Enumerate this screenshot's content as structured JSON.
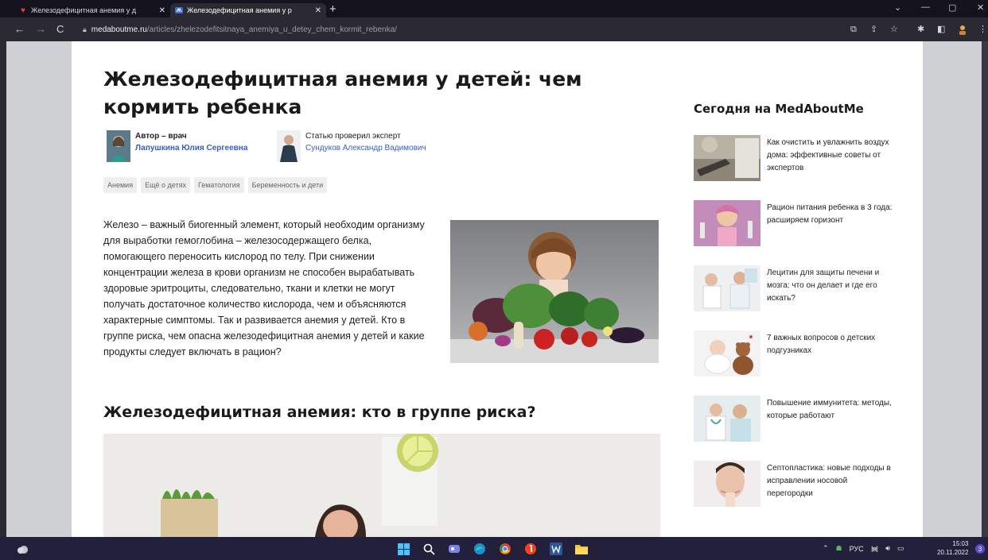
{
  "browser": {
    "tabs": [
      {
        "title": "Железодефицитная анемия у д",
        "close": "✕",
        "active": false
      },
      {
        "title": "Железодефицитная анемия у р",
        "close": "✕",
        "active": true
      }
    ],
    "new_tab": "+",
    "url_domain": "medaboutme.ru",
    "url_path": "/articles/zhelezodefitsitnaya_anemiya_u_detey_chem_kormit_rebenka/",
    "window_controls": {
      "min": "—",
      "max": "▢",
      "close": "✕"
    }
  },
  "article": {
    "title": "Железодефицитная анемия у детей: чем кормить ребенка",
    "author": {
      "label": "Автор – врач",
      "name": "Лапушкина Юлия Сергеевна"
    },
    "expert": {
      "label": "Статью проверил эксперт",
      "name": "Сундуков Александр Вадимович"
    },
    "tags": [
      "Анемия",
      "Ещё о детях",
      "Гематология",
      "Беременность и дети"
    ],
    "intro": "Железо – важный биогенный элемент, который необходим организму для выработки гемоглобина – железосодержащего белка, помогающего переносить кислород по телу. При снижении концентрации железа в крови организм не способен вырабатывать здоровые эритроциты, следовательно, ткани и клетки не могут получать достаточное количество кислорода, чем и объясняются характерные симптомы. Так и развивается анемия у детей. Кто в группе риска, чем опасна железодефицитная анемия у детей и какие продукты следует включать в рацион?",
    "section_heading": "Железодефицитная анемия: кто в группе риска?"
  },
  "sidebar": {
    "title": "Сегодня на MedAboutMe",
    "items": [
      {
        "text": "Как очистить и увлажнить воздух дома: эффективные советы от экспертов"
      },
      {
        "text": "Рацион питания ребенка в 3 года: расширяем горизонт"
      },
      {
        "text": "Лецитин для защиты печени и мозга: что он делает и где его искать?"
      },
      {
        "text": "7 важных вопросов о детских подгузниках"
      },
      {
        "text": "Повышение иммунитета: методы, которые работают"
      },
      {
        "text": "Септопластика: новые подходы в исправлении носовой перегородки"
      }
    ]
  },
  "taskbar": {
    "language": "РУС",
    "time": "15:03",
    "date": "20.11.2022",
    "notification_count": "3"
  }
}
